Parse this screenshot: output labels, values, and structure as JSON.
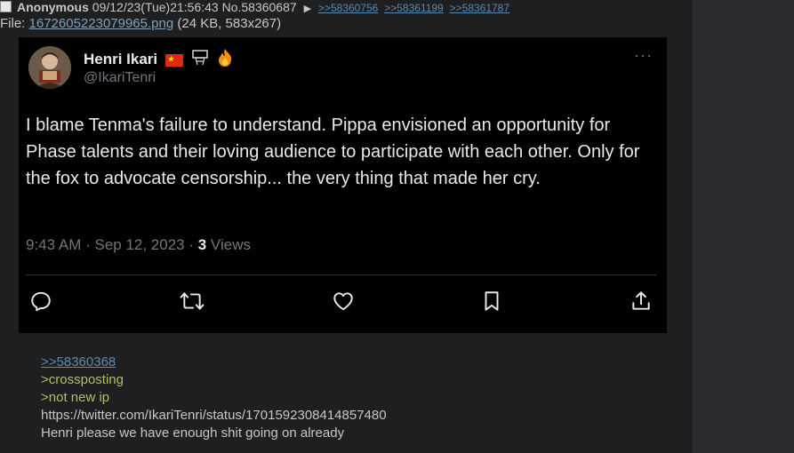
{
  "post": {
    "name": "Anonymous",
    "datetime": "09/12/23(Tue)21:56:43",
    "number": "No.58360687",
    "menu_arrow": "▶",
    "backlinks": [
      ">>58360756",
      ">>58361199",
      ">>58361787"
    ],
    "file_prefix": "File: ",
    "file_name": "1672605223079965.png",
    "file_info": "(24 KB, 583x267)"
  },
  "tweet": {
    "display_name": "Henri Ikari",
    "handle": "@IkariTenri",
    "more": "···",
    "text": "I blame Tenma's failure to understand. Pippa envisioned an opportunity for Phase talents and their loving audience to participate with each other. Only for the fox to advocate censorship... the very thing that made her cry.",
    "timestamp": "9:43 AM · Sep 12, 2023 · ",
    "views_count": "3",
    "views_label": " Views",
    "icons": [
      "reply-icon",
      "retweet-icon",
      "like-icon",
      "bookmark-icon",
      "share-icon"
    ],
    "emojis": [
      "china-flag-icon",
      "basketball-hoop-icon",
      "fire-icon"
    ]
  },
  "comment": {
    "quote_link": ">>58360368",
    "greentext_1": ">crossposting",
    "greentext_2": ">not new ip",
    "url": "https://twitter.com/IkariTenri/status/1701592308414857480",
    "message": "Henri please we have enough shit going on already"
  },
  "colors": {
    "background": "#1d1f21",
    "text": "#c5c8c6",
    "link": "#81a2be",
    "greentext": "#b5bd68",
    "tweet_bg": "#000000",
    "tweet_muted": "#71767b"
  }
}
